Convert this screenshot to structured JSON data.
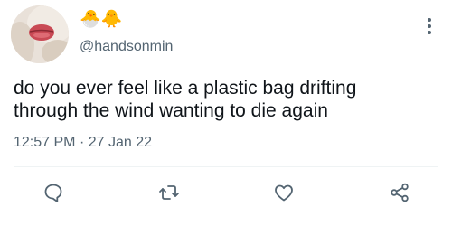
{
  "user": {
    "display_name": "🐣🐥",
    "handle": "@handsonmin",
    "avatar_icon": "profile-photo-lips"
  },
  "tweet": {
    "text": "do you ever feel like a plastic bag drifting\nthrough the wind wanting to die again",
    "time": "12:57 PM",
    "separator": "·",
    "date": "27 Jan 22"
  },
  "actions": [
    {
      "name": "reply",
      "icon": "speech-bubble-icon"
    },
    {
      "name": "retweet",
      "icon": "retweet-icon"
    },
    {
      "name": "like",
      "icon": "heart-icon"
    },
    {
      "name": "share",
      "icon": "share-icon"
    }
  ],
  "colors": {
    "text": "#0f1419",
    "secondary": "#536471",
    "icon": "#536471",
    "divider": "#eff3f4"
  }
}
